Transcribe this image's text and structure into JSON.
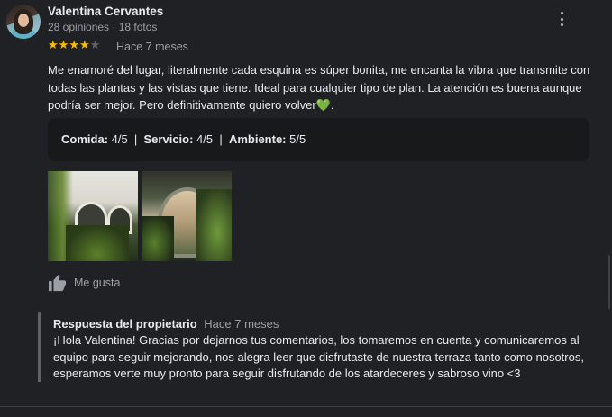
{
  "reviewer": {
    "name": "Valentina Cervantes",
    "meta": "28 opiniones · 18 fotos"
  },
  "review": {
    "rating": 4,
    "max_rating": 5,
    "time_ago": "Hace 7 meses",
    "text": "Me enamoré del lugar, literalmente cada esquina es súper bonita, me encanta la vibra que transmite con todas las plantas y las vistas que tiene. Ideal para cualquier tipo de plan. La atención es buena aunque podría ser mejor. Pero definitivamente quiero volver",
    "text_end": ".",
    "heart": "💚"
  },
  "scores": [
    {
      "label": "Comida:",
      "value": "4/5"
    },
    {
      "label": "Servicio:",
      "value": "4/5"
    },
    {
      "label": "Ambiente:",
      "value": "5/5"
    }
  ],
  "scores_separator": "|",
  "like": {
    "icon": "thumbs-up-icon",
    "label": "Me gusta"
  },
  "owner_reply": {
    "title": "Respuesta del propietario",
    "time_ago": "Hace 7 meses",
    "text": "¡Hola Valentina! Gracias por dejarnos tus comentarios, los tomaremos en cuenta y comunicaremos al equipo para seguir mejorando, nos alegra leer que disfrutaste de nuestra terraza tanto como nosotros, esperamos verte muy pronto para seguir disfrutando de los atardeceres y sabroso vino <3"
  },
  "colors": {
    "background": "#202124",
    "star": "#fbbc04",
    "heart": "#34a853",
    "secondary_text": "#9aa0a6"
  }
}
